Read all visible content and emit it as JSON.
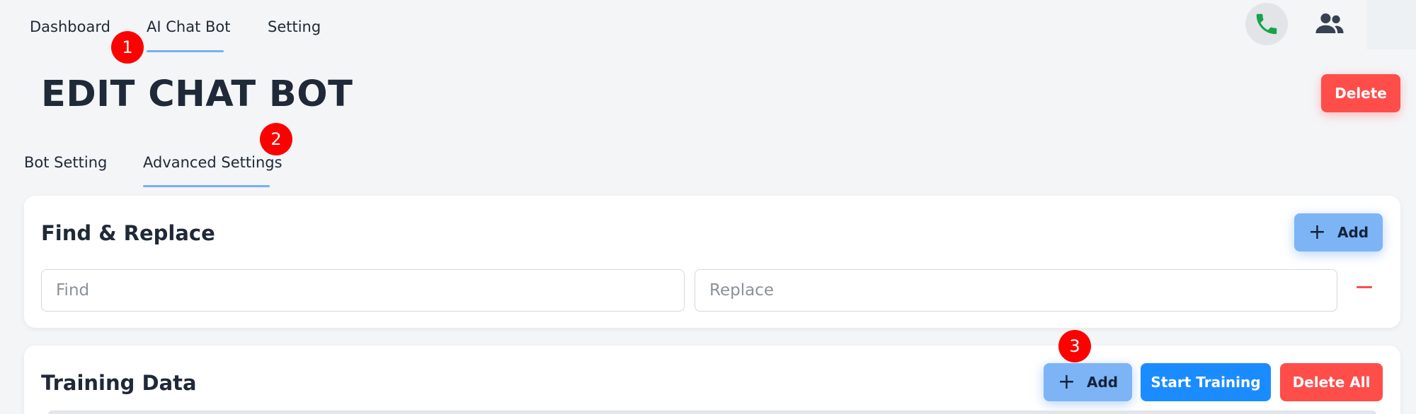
{
  "nav": {
    "items": [
      {
        "label": "Dashboard"
      },
      {
        "label": "AI Chat Bot"
      },
      {
        "label": "Setting"
      }
    ]
  },
  "badges": [
    "1",
    "2",
    "3"
  ],
  "header": {
    "title": "EDIT CHAT BOT",
    "delete_label": "Delete"
  },
  "tabs": [
    {
      "label": "Bot Setting"
    },
    {
      "label": "Advanced Settings"
    }
  ],
  "find_replace": {
    "title": "Find & Replace",
    "add_label": "Add",
    "find_placeholder": "Find",
    "replace_placeholder": "Replace"
  },
  "training": {
    "title": "Training Data",
    "add_label": "Add",
    "start_label": "Start Training",
    "delete_all_label": "Delete All"
  },
  "icons": {
    "phone": "phone-icon",
    "users": "users-icon"
  },
  "colors": {
    "accent": "#1b8cff",
    "danger": "#ff4d4a",
    "light_accent": "#7db4f5",
    "phone": "#16a34a"
  }
}
